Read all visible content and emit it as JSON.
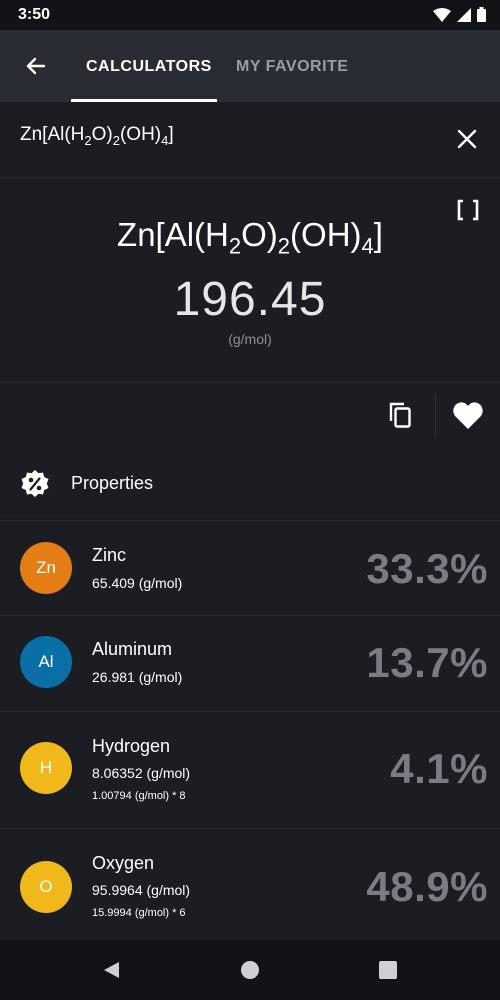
{
  "status": {
    "time": "3:50"
  },
  "tabs": {
    "calculators": "CALCULATORS",
    "favorite": "MY FAVORITE"
  },
  "input": {
    "base": "Zn[Al(H",
    "sub1": "2",
    "mid": "O)",
    "sub2": "2",
    "end": "(OH)",
    "sub3": "4",
    "close": "]"
  },
  "result": {
    "formula": {
      "base": "Zn[Al(H",
      "sub1": "2",
      "mid": "O)",
      "sub2": "2",
      "end": "(OH)",
      "sub3": "4",
      "close": "]"
    },
    "molar_mass": "196.45",
    "unit": "(g/mol)"
  },
  "properties": {
    "title": "Properties"
  },
  "elements": [
    {
      "symbol": "Zn",
      "name": "Zinc",
      "mass": "65.409 (g/mol)",
      "detail": "",
      "percent": "33.3%",
      "color": "#e47e14"
    },
    {
      "symbol": "Al",
      "name": "Aluminum",
      "mass": "26.981 (g/mol)",
      "detail": "",
      "percent": "13.7%",
      "color": "#0a6fa6"
    },
    {
      "symbol": "H",
      "name": "Hydrogen",
      "mass": "8.06352 (g/mol)",
      "detail": "1.00794 (g/mol) * 8",
      "percent": "4.1%",
      "color": "#f1b81c"
    },
    {
      "symbol": "O",
      "name": "Oxygen",
      "mass": "95.9964 (g/mol)",
      "detail": "15.9994 (g/mol) * 6",
      "percent": "48.9%",
      "color": "#f1b81c"
    }
  ],
  "icons": {
    "back": "back-arrow-icon",
    "clear": "close-icon",
    "expand": "expand-icon",
    "copy": "copy-icon",
    "favorite": "heart-icon",
    "properties": "percent-badge-icon"
  }
}
